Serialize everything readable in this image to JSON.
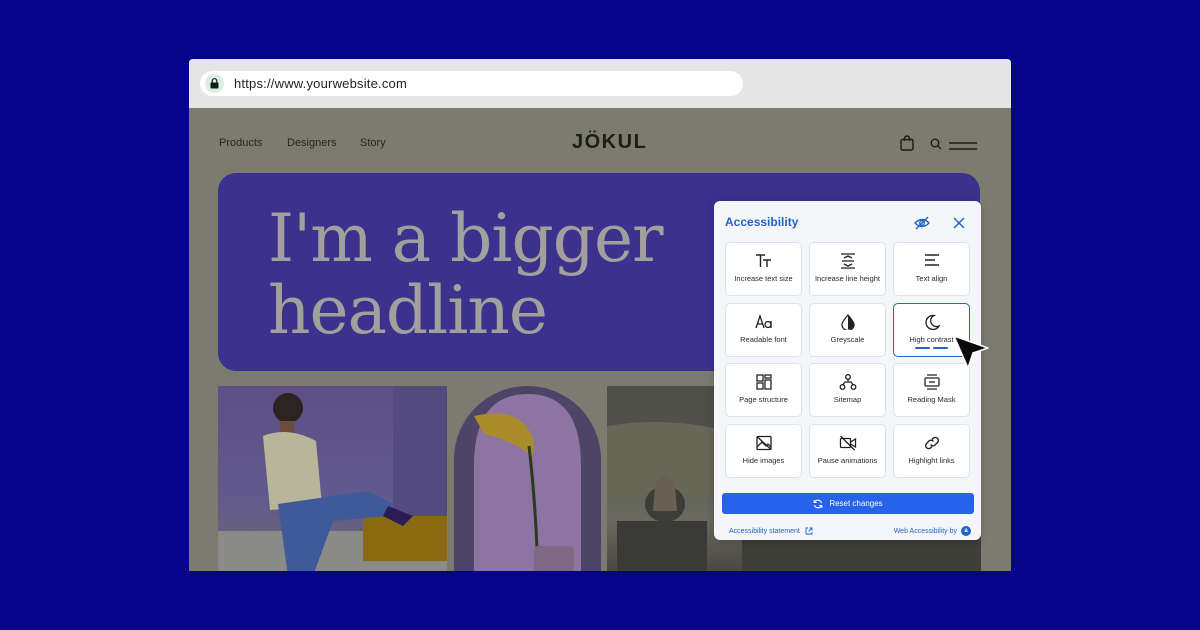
{
  "browser": {
    "url": "https://www.yourwebsite.com"
  },
  "site": {
    "nav": [
      "Products",
      "Designers",
      "Story"
    ],
    "logo": "JÖKUL",
    "headline_line1": "I'm a bigger",
    "headline_line2": "headline"
  },
  "panel": {
    "title": "Accessibility",
    "tiles": [
      {
        "label": "Increase text size",
        "icon": "text-size-icon"
      },
      {
        "label": "Increase line height",
        "icon": "line-height-icon"
      },
      {
        "label": "Text align",
        "icon": "text-align-icon"
      },
      {
        "label": "Readable font",
        "icon": "readable-font-icon"
      },
      {
        "label": "Greyscale",
        "icon": "greyscale-icon"
      },
      {
        "label": "High contrast",
        "icon": "moon-icon",
        "active": true
      },
      {
        "label": "Page structure",
        "icon": "page-structure-icon"
      },
      {
        "label": "Sitemap",
        "icon": "sitemap-icon"
      },
      {
        "label": "Reading Mask",
        "icon": "reading-mask-icon"
      },
      {
        "label": "Hide images",
        "icon": "hide-images-icon"
      },
      {
        "label": "Pause animations",
        "icon": "pause-animations-icon"
      },
      {
        "label": "Highlight links",
        "icon": "link-icon"
      }
    ],
    "reset_label": "Reset changes",
    "statement_link": "Accessibility statement",
    "powered_by": "Web Accessibility by"
  },
  "colors": {
    "accent": "#2563eb",
    "background": "#06058a",
    "hero": "#3c318d"
  }
}
